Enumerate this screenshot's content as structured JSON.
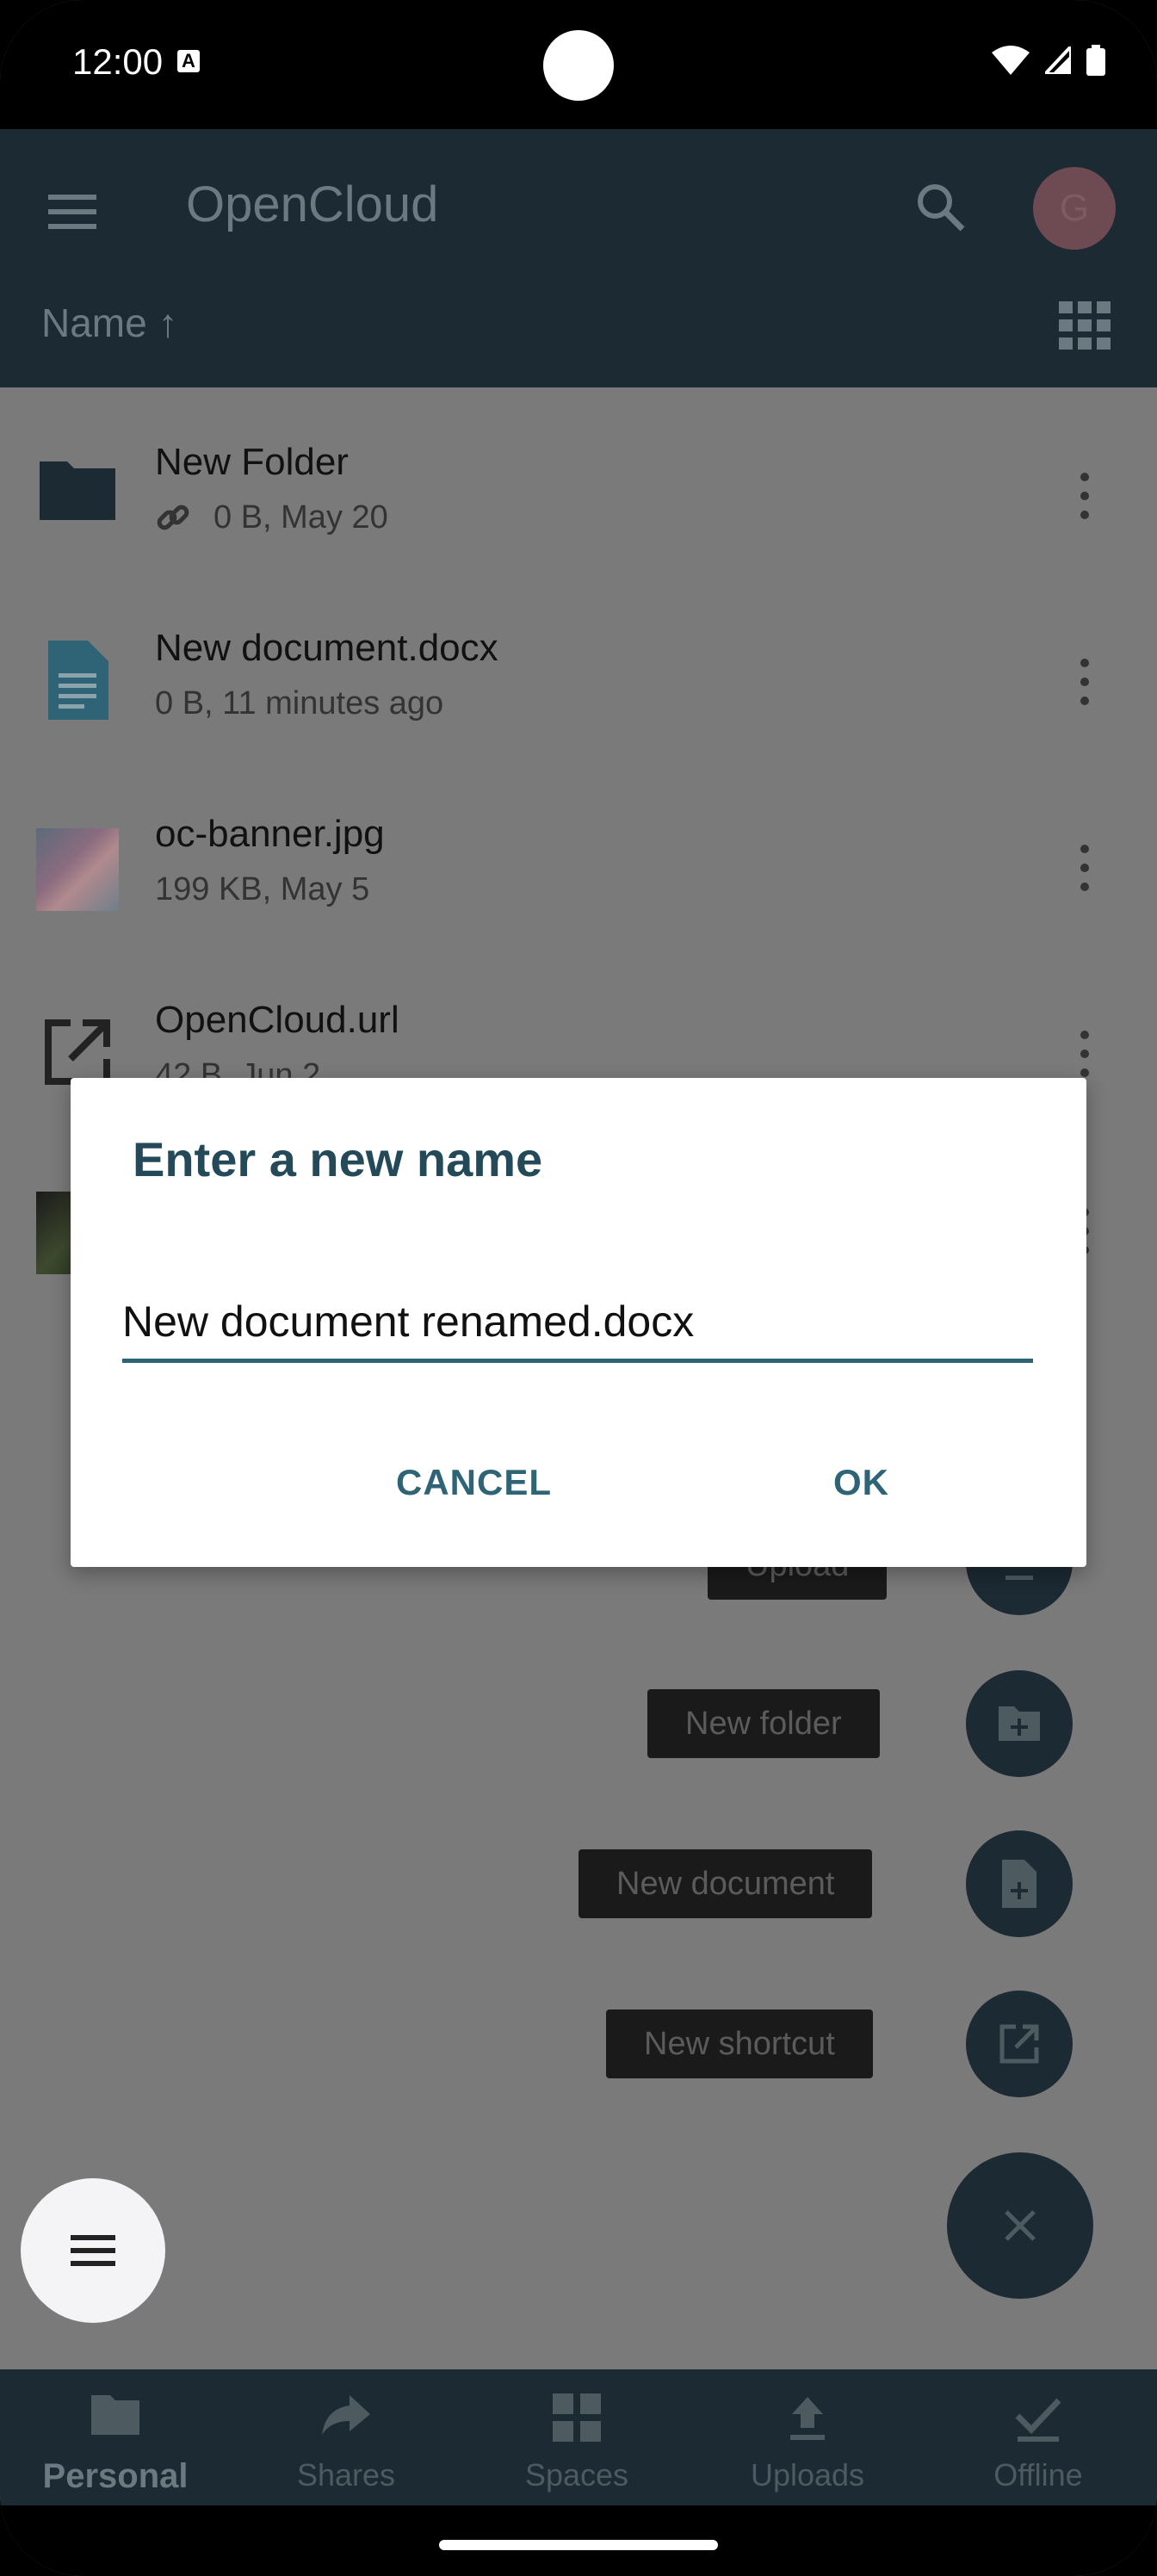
{
  "status_bar": {
    "time": "12:00",
    "notification_badge": "A"
  },
  "app_bar": {
    "title": "OpenCloud",
    "avatar_initial": "G"
  },
  "sort_bar": {
    "label": "Name ↑"
  },
  "files": [
    {
      "name": "New Folder",
      "meta": "0 B, May 20",
      "icon": "folder-icon",
      "shared_link": true
    },
    {
      "name": "New document.docx",
      "meta": "0 B, 11 minutes ago",
      "icon": "document-icon"
    },
    {
      "name": "oc-banner.jpg",
      "meta": "199 KB, May 5",
      "icon": "image-thumbnail"
    },
    {
      "name": "OpenCloud.url",
      "meta": "42 B, Jun 2",
      "icon": "shortcut-icon"
    }
  ],
  "fab_menu": {
    "upload": "Upload",
    "new_folder": "New folder",
    "new_document": "New document",
    "new_shortcut": "New shortcut"
  },
  "dialog": {
    "title": "Enter a new name",
    "input_value": "New document renamed.docx",
    "cancel_label": "CANCEL",
    "ok_label": "OK"
  },
  "bottom_nav": [
    {
      "label": "Personal",
      "icon": "folder-icon",
      "active": true
    },
    {
      "label": "Shares",
      "icon": "share-icon",
      "active": false
    },
    {
      "label": "Spaces",
      "icon": "grid-icon",
      "active": false
    },
    {
      "label": "Uploads",
      "icon": "upload-icon",
      "active": false
    },
    {
      "label": "Offline",
      "icon": "check-icon",
      "active": false
    }
  ],
  "colors": {
    "primary_dark": "#1c2a33",
    "accent": "#2e6476",
    "dialog_title": "#244a59",
    "scrim": "#7a7a7a"
  }
}
